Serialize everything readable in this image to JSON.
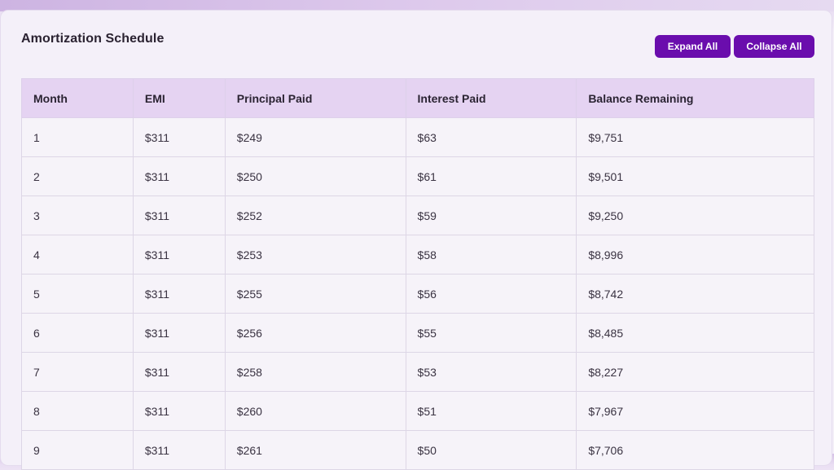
{
  "header": {
    "title": "Amortization Schedule",
    "expand_label": "Expand All",
    "collapse_label": "Collapse All"
  },
  "colors": {
    "accent": "#6a0dad",
    "header_row": "#e5d3f2",
    "background": "#f4f0f9"
  },
  "table": {
    "columns": [
      "Month",
      "EMI",
      "Principal Paid",
      "Interest Paid",
      "Balance Remaining"
    ],
    "rows": [
      [
        "1",
        "$311",
        "$249",
        "$63",
        "$9,751"
      ],
      [
        "2",
        "$311",
        "$250",
        "$61",
        "$9,501"
      ],
      [
        "3",
        "$311",
        "$252",
        "$59",
        "$9,250"
      ],
      [
        "4",
        "$311",
        "$253",
        "$58",
        "$8,996"
      ],
      [
        "5",
        "$311",
        "$255",
        "$56",
        "$8,742"
      ],
      [
        "6",
        "$311",
        "$256",
        "$55",
        "$8,485"
      ],
      [
        "7",
        "$311",
        "$258",
        "$53",
        "$8,227"
      ],
      [
        "8",
        "$311",
        "$260",
        "$51",
        "$7,967"
      ],
      [
        "9",
        "$311",
        "$261",
        "$50",
        "$7,706"
      ]
    ]
  }
}
